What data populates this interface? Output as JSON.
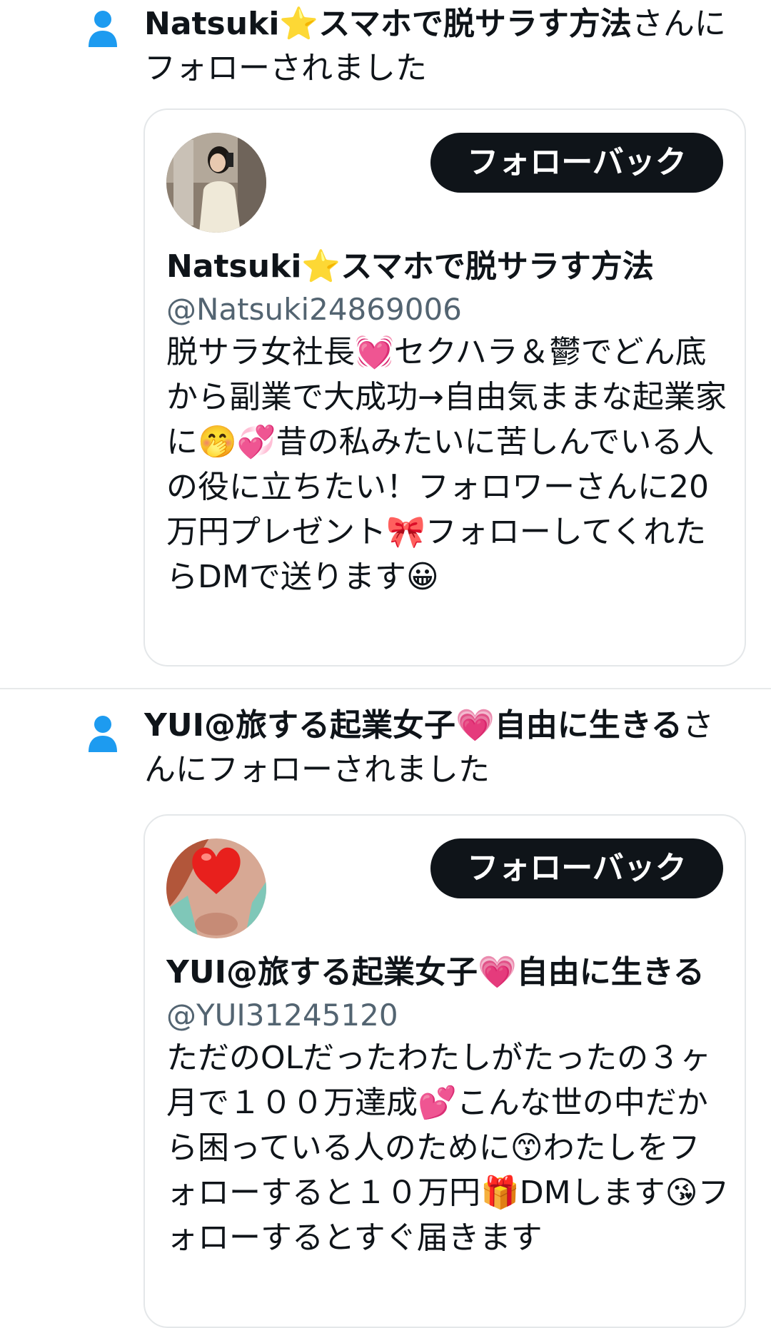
{
  "colors": {
    "icon_blue": "#1d9bf0",
    "text": "#0f1419",
    "muted": "#536471",
    "button_bg": "#0f1419",
    "button_fg": "#ffffff",
    "card_border": "#e4e7e9"
  },
  "notifications": [
    {
      "icon": "person-icon",
      "actor_name": "Natsuki⭐スマホで脱サラす方法",
      "action_text": "さんにフォローされました",
      "card": {
        "follow_back_label": "フォローバック",
        "display_name": "Natsuki⭐スマホで脱サラす方法",
        "handle": "@Natsuki24869006",
        "bio": "脱サラ女社長💓セクハラ＆鬱でどん底から副業で大成功→自由気ままな起業家に🤭💞昔の私みたいに苦しんでいる人の役に立ちたい！フォロワーさんに20万円プレゼント🎀フォローしてくれたらDMで送ります😀"
      }
    },
    {
      "icon": "person-icon",
      "actor_name": "YUI@旅する起業女子💗自由に生きる",
      "action_text": "さんにフォローされました",
      "card": {
        "follow_back_label": "フォローバック",
        "display_name": "YUI@旅する起業女子💗自由に生きる",
        "handle": "@YUI31245120",
        "bio": "ただのOLだったわたしがたったの３ヶ月で１００万達成💕こんな世の中だから困っている人のために😙わたしをフォローすると１０万円🎁DMします😘フォローするとすぐ届きます"
      }
    }
  ]
}
